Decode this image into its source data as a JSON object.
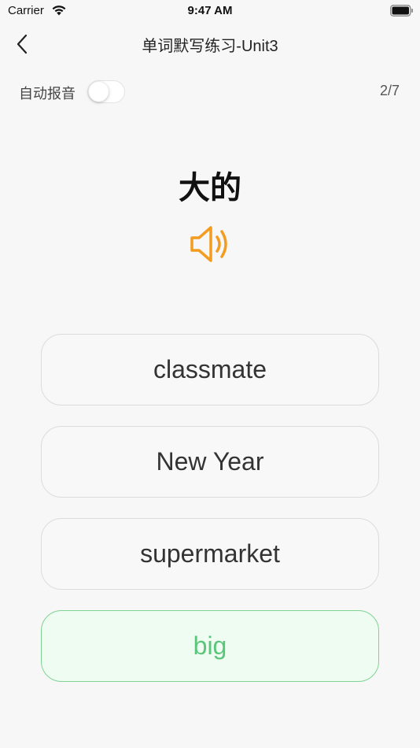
{
  "status_bar": {
    "carrier": "Carrier",
    "time": "9:47 AM"
  },
  "nav": {
    "title": "单词默写练习-Unit3"
  },
  "toolbar": {
    "auto_play_label": "自动报音",
    "auto_play_on": false,
    "progress": "2/7"
  },
  "question": {
    "word": "大的"
  },
  "options": [
    {
      "label": "classmate",
      "state": "default"
    },
    {
      "label": "New Year",
      "state": "default"
    },
    {
      "label": "supermarket",
      "state": "default"
    },
    {
      "label": "big",
      "state": "correct"
    }
  ],
  "colors": {
    "speaker": "#f39c1f",
    "correct_text": "#5bc57a",
    "correct_border": "#7fd392",
    "correct_bg": "#eefcf1"
  }
}
